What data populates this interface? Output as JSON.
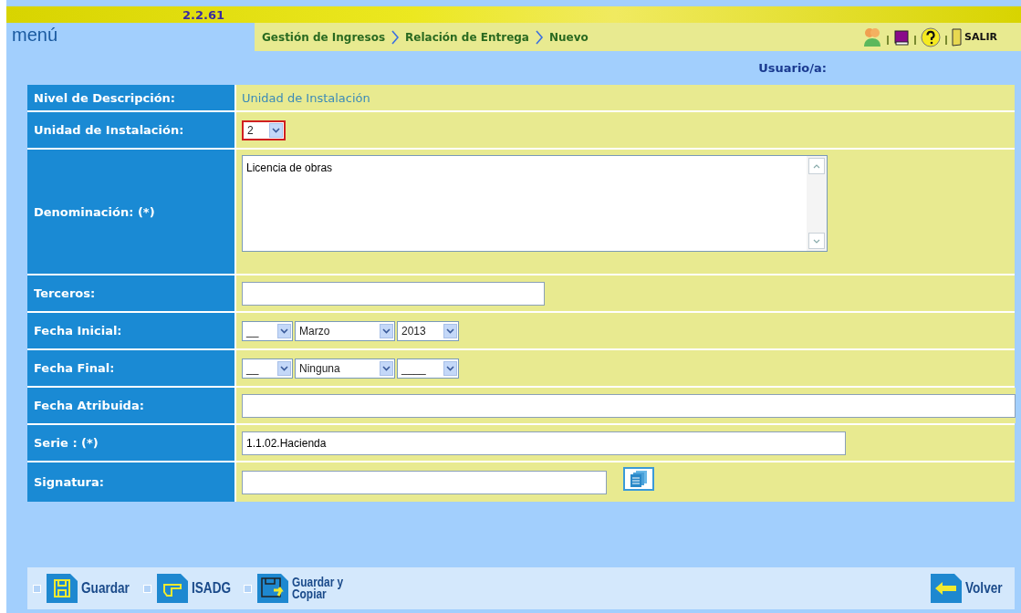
{
  "header": {
    "version": "2.2.61",
    "menu": "menú",
    "breadcrumb": [
      "Gestión de Ingresos",
      "Relación de Entrega",
      "Nuevo"
    ],
    "exit": "SALIR",
    "user_label": "Usuario/a:"
  },
  "form": [
    {
      "label": "Nivel de Descripción:",
      "kind": "text",
      "value": "Unidad de Instalación"
    },
    {
      "label": "Unidad de Instalación:",
      "kind": "selects",
      "selects": [
        {
          "value": "2",
          "focused": true
        }
      ]
    },
    {
      "label": "Denominación: (*)",
      "kind": "textarea",
      "value": "Licencia de obras"
    },
    {
      "label": "Terceros:",
      "kind": "input"
    },
    {
      "label": "Fecha Inicial:",
      "kind": "selects",
      "selects": [
        {
          "value": "__",
          "focused": false
        },
        {
          "value": "Marzo",
          "focused": false
        },
        {
          "value": "2013",
          "focused": false
        }
      ]
    },
    {
      "label": "Fecha Final:",
      "kind": "selects",
      "selects": [
        {
          "value": "__",
          "focused": false
        },
        {
          "value": "Ninguna",
          "focused": false
        },
        {
          "value": "____",
          "focused": false
        }
      ]
    },
    {
      "label": "Fecha Atribuida:",
      "kind": "input"
    },
    {
      "label": "Serie : (*)",
      "kind": "input",
      "value": "1.1.02.Hacienda"
    },
    {
      "label": "Signatura:",
      "kind": "lookup"
    }
  ],
  "actions": [
    "Guardar",
    "ISADG",
    "Guardar y Copiar"
  ],
  "back": "Volver"
}
